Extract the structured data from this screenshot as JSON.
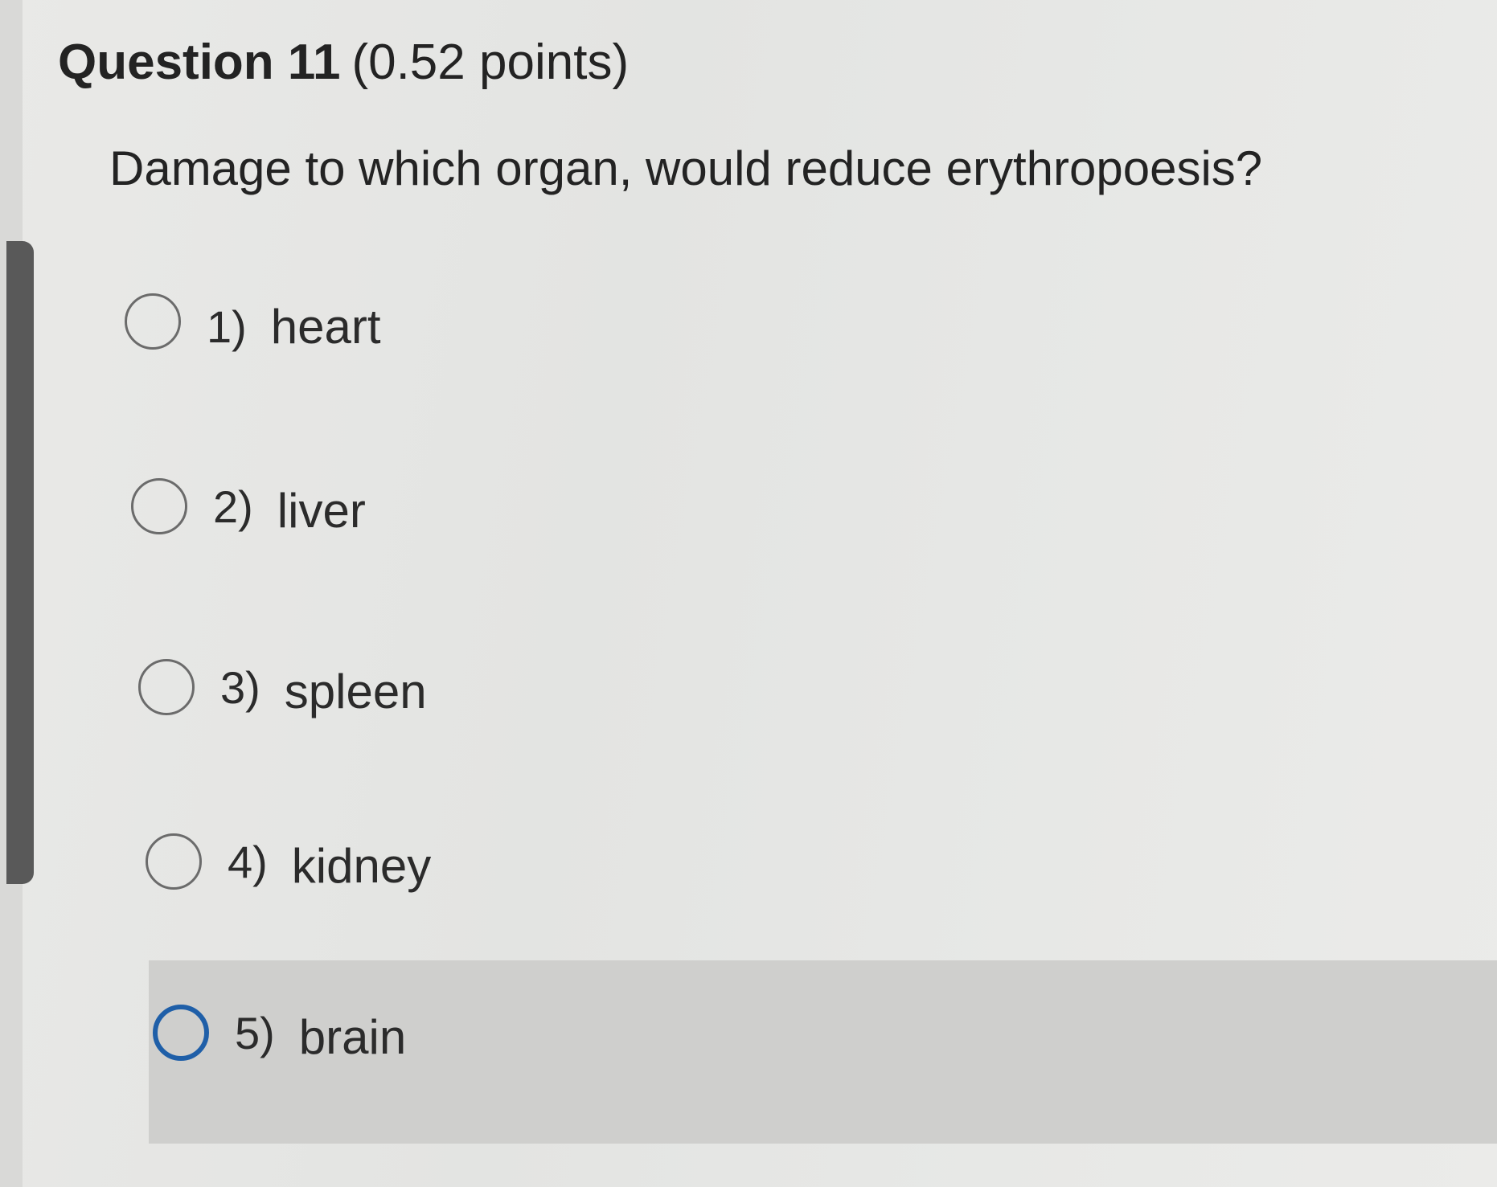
{
  "question": {
    "title": "Question 11",
    "points": "(0.52 points)",
    "text": "Damage to which organ, would reduce erythropoesis?"
  },
  "options": [
    {
      "number": "1)",
      "label": "heart"
    },
    {
      "number": "2)",
      "label": "liver"
    },
    {
      "number": "3)",
      "label": "spleen"
    },
    {
      "number": "4)",
      "label": "kidney"
    },
    {
      "number": "5)",
      "label": "brain"
    }
  ],
  "colors": {
    "focused_radio": "#1f5fa8",
    "hover_row": "#cfcfcd",
    "scrollbar_thumb": "#595959"
  }
}
